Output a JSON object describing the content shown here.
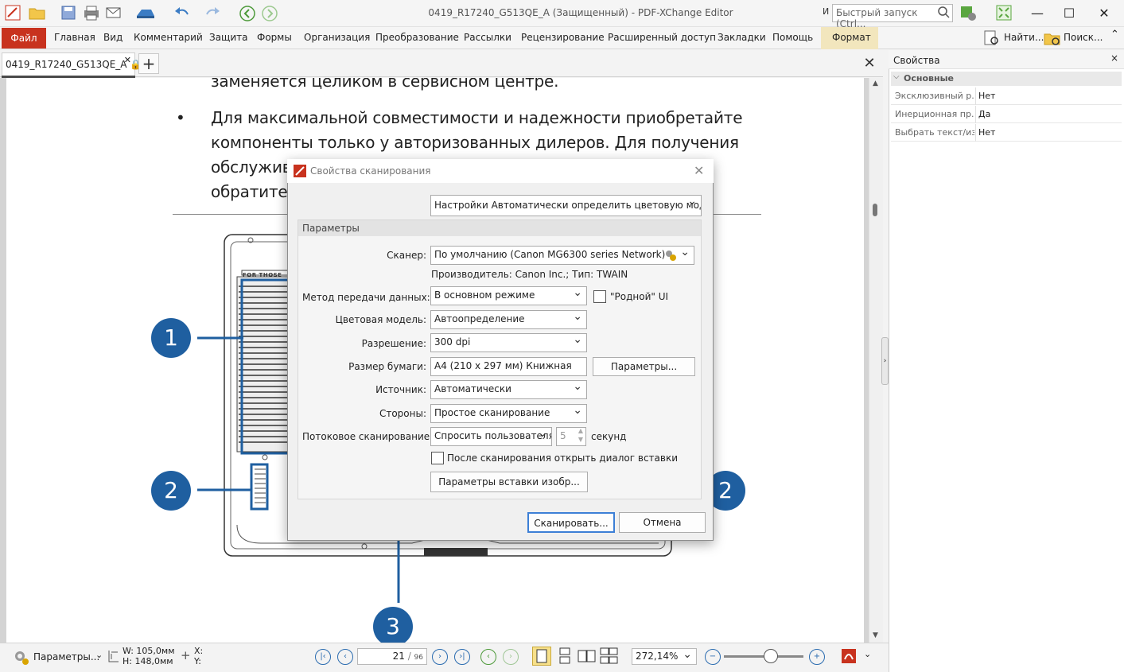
{
  "titlebar": {
    "title": "0419_R17240_G513QE_A (Защищенный) - PDF-XChange Editor",
    "quick_launch_prefix": "И",
    "quick_launch_placeholder": "Быстрый запуск (Ctrl...",
    "minimize": "—",
    "maximize": "☐",
    "close": "✕"
  },
  "menu": {
    "file": "Файл",
    "items": [
      "Главная",
      "Вид",
      "Комментарий",
      "Защита",
      "Формы",
      "Организация",
      "Преобразование",
      "Рассылки",
      "Рецензирование",
      "Расширенный доступ",
      "Закладки",
      "Помощь"
    ],
    "format": "Формат",
    "find": "Найти...",
    "search": "Поиск..."
  },
  "doc_tab": {
    "name": "0419_R17240_G513QE_A",
    "new_tab": "+",
    "close": "✕"
  },
  "document": {
    "lines": [
      "заменяется целиком в сервисном центре.",
      "Для максимальной совместимости и надежности приобретайте",
      "компоненты только у авторизованных дилеров. Для получения",
      "обслуживания обращайтесь в авторизованный сервисный",
      "обратитесь"
    ],
    "bullet": "•",
    "panel_label": "FOR THOSE",
    "callouts": [
      "1",
      "2",
      "2",
      "3"
    ]
  },
  "properties": {
    "title": "Свойства",
    "close": "×",
    "group": "Основные",
    "rows": [
      {
        "name": "Эксклюзивный р...",
        "value": "Нет"
      },
      {
        "name": "Инерционная пр...",
        "value": "Да"
      },
      {
        "name": "Выбрать текст/из...",
        "value": "Нет"
      }
    ]
  },
  "statusbar": {
    "options": "Параметры...",
    "width": "W: 105,0мм",
    "height": "H: 148,0мм",
    "x": "X:",
    "y": "Y:",
    "page": "21",
    "page_total": "96",
    "zoom": "272,14%"
  },
  "dialog": {
    "title": "Свойства сканирования",
    "settings": "Настройки  Автоматически определить цветовую моде...",
    "group_label": "Параметры",
    "scanner_label": "Сканер:",
    "scanner_value": "По умолчанию (Canon MG6300 series Network)",
    "manufacturer": "Производитель: Canon Inc.; Тип: TWAIN",
    "transfer_label": "Метод передачи данных:",
    "transfer_value": "В основном режиме",
    "native_ui": "\"Родной\" UI",
    "color_label": "Цветовая модель:",
    "color_value": "Автоопределение",
    "resolution_label": "Разрешение:",
    "resolution_value": "300 dpi",
    "paper_label": "Размер бумаги:",
    "paper_value": "A4 (210 x 297 мм) Книжная",
    "paper_button": "Параметры...",
    "source_label": "Источник:",
    "source_value": "Автоматически",
    "sides_label": "Стороны:",
    "sides_value": "Простое сканирование",
    "stream_label": "Потоковое сканирование:",
    "stream_value": "Спросить пользователя",
    "seconds_value": "5",
    "seconds_label": "секунд",
    "after_scan": "После сканирования открыть диалог вставки",
    "insert_params": "Параметры вставки изобр...",
    "scan_button": "Сканировать...",
    "cancel_button": "Отмена"
  }
}
